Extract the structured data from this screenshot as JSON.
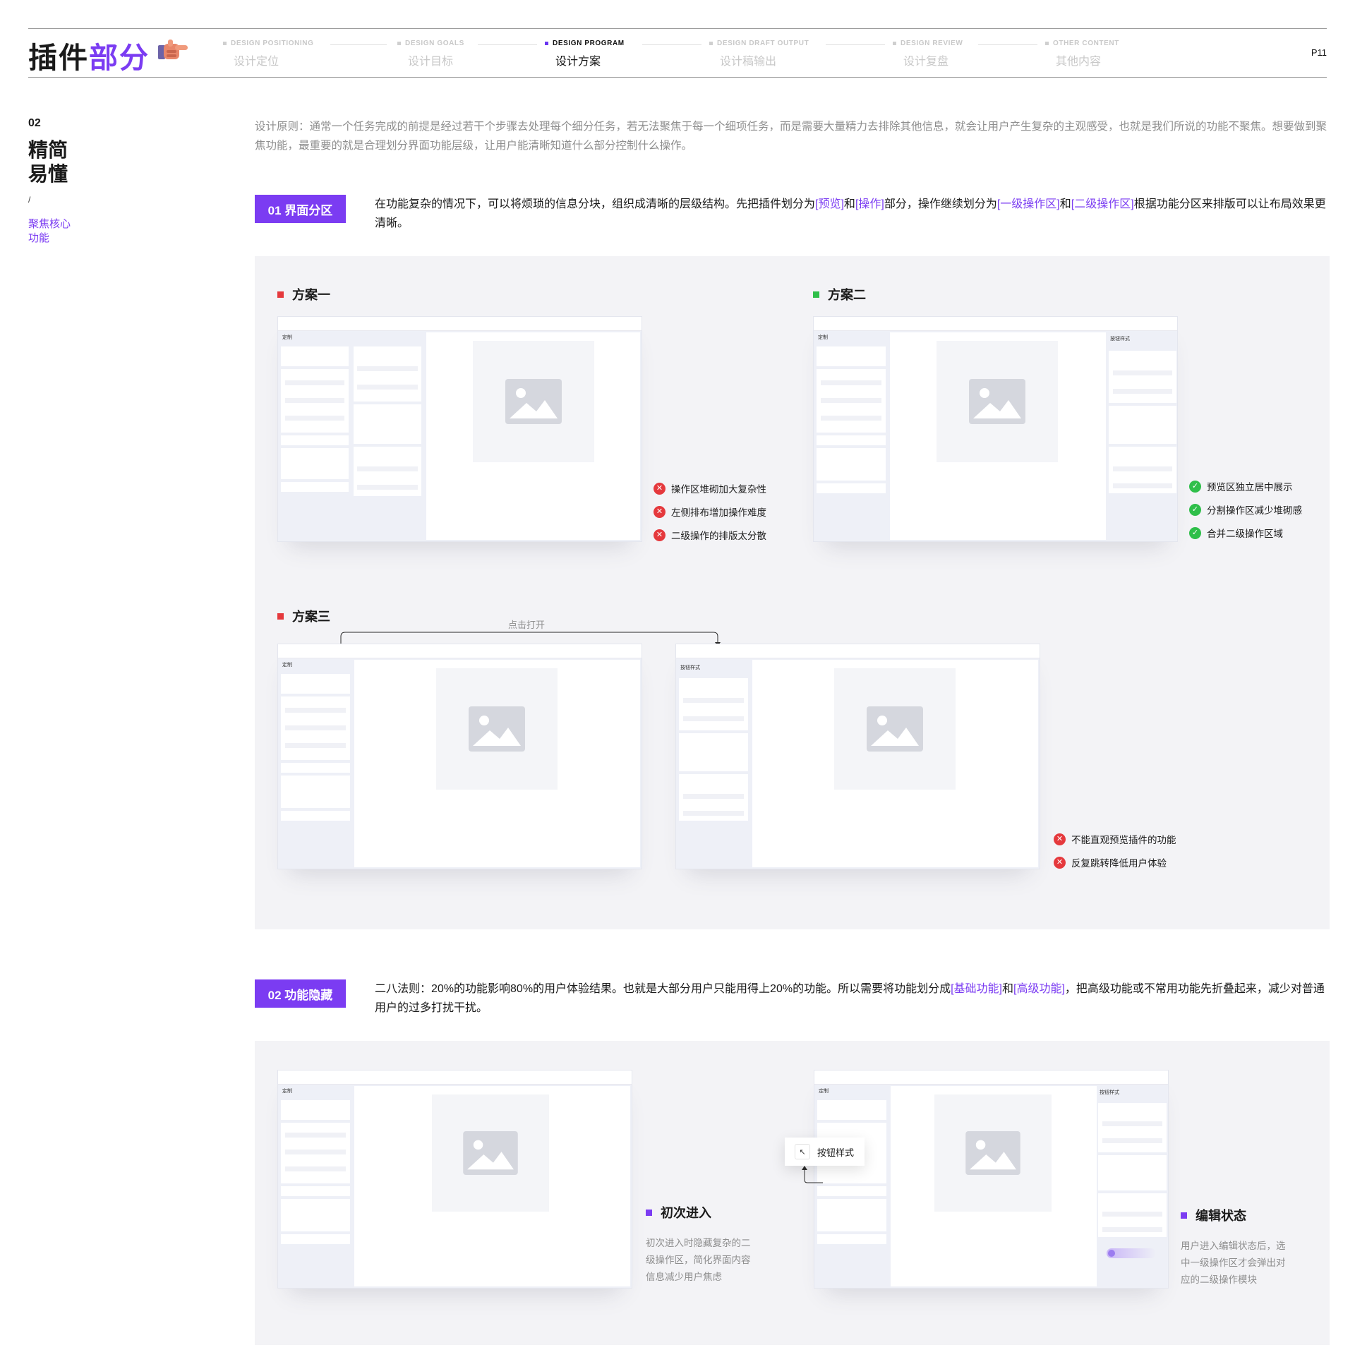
{
  "header": {
    "title_part1": "插件",
    "title_part2": "部分",
    "page_num": "P11",
    "nav": [
      {
        "en": "DESIGN POSITIONING",
        "cn": "设计定位",
        "active": false
      },
      {
        "en": "DESIGN GOALS",
        "cn": "设计目标",
        "active": false
      },
      {
        "en": "DESIGN PROGRAM",
        "cn": "设计方案",
        "active": true
      },
      {
        "en": "DESIGN DRAFT OUTPUT",
        "cn": "设计稿输出",
        "active": false
      },
      {
        "en": "DESIGN REVIEW",
        "cn": "设计复盘",
        "active": false
      },
      {
        "en": "OTHER CONTENT",
        "cn": "其他内容",
        "active": false
      }
    ]
  },
  "side": {
    "num": "02",
    "title_line1": "精简",
    "title_line2": "易懂",
    "slash": "/",
    "sub_line1": "聚焦核心",
    "sub_line2": "功能"
  },
  "intro": "设计原则：通常一个任务完成的前提是经过若干个步骤去处理每个细分任务，若无法聚焦于每一个细项任务，而是需要大量精力去排除其他信息，就会让用户产生复杂的主观感受，也就是我们所说的功能不聚焦。想要做到聚焦功能，最重要的就是合理划分界面功能层级，让用户能清晰知道什么部分控制什么操作。",
  "section1": {
    "badge": "01  界面分区",
    "para": {
      "t1": "在功能复杂的情况下，可以将烦琐的信息分块，组织成清晰的层级结构。先把插件划分为",
      "h1": "[预览]",
      "t2": "和",
      "h2": "[操作]",
      "t3": "部分，操作继续划分为",
      "h3": "[一级操作区]",
      "t4": "和",
      "h4": "[二级操作区]",
      "t5": "根据功能分区来排版可以让布局效果更清晰。"
    },
    "plans": [
      {
        "label": "方案一",
        "color": "#e5393d",
        "notes": [
          "操作区堆砌加大复杂性",
          "左侧排布增加操作难度",
          "二级操作的排版太分散"
        ],
        "type": "bad"
      },
      {
        "label": "方案二",
        "color": "#2fbf4a",
        "notes": [
          "预览区独立居中展示",
          "分割操作区减少堆砌感",
          "合并二级操作区域"
        ],
        "type": "good"
      },
      {
        "label": "方案三",
        "color": "#e5393d",
        "notes": [
          "不能直观预览插件的功能",
          "反复跳转降低用户体验"
        ],
        "type": "bad"
      }
    ],
    "click_label": "点击打开"
  },
  "section2": {
    "badge": "02  功能隐藏",
    "para": {
      "t1": "二八法则：20%的功能影响80%的用户体验结果。也就是大部分用户只能用得上20%的功能。所以需要将功能划分成",
      "h1": "[基础功能]",
      "t2": "和",
      "h2": "[高级功能]",
      "t3": "，把高级功能或不常用功能先折叠起来，减少对普通用户的过多打扰干扰。"
    },
    "first": {
      "title": "初次进入",
      "desc1": "初次进入时隐藏复杂的二",
      "desc2": "级操作区，简化界面内容",
      "desc3": "信息减少用户焦虑"
    },
    "edit": {
      "title": "编辑状态",
      "desc1": "用户进入编辑状态后，选",
      "desc2": "中一级操作区才会弹出对",
      "desc3": "应的二级操作模块"
    },
    "popup_label": "按钮样式"
  },
  "mock": {
    "custom": "定制",
    "button_style": "按钮样式"
  },
  "colors": {
    "accent": "#7b3cf2",
    "bad": "#e5393d",
    "good": "#2fbf4a",
    "panel": "#f3f3f6"
  }
}
